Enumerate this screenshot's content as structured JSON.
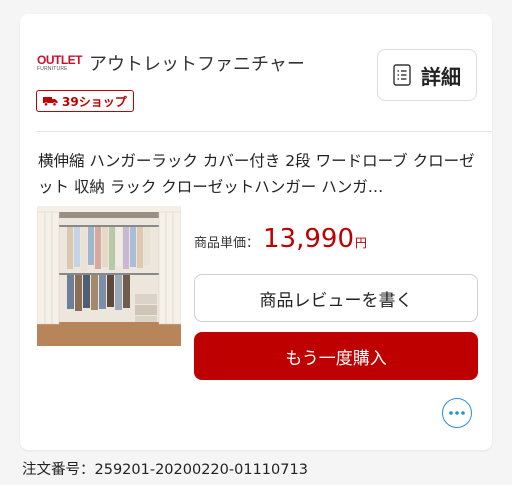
{
  "shop": {
    "logo_line1": "OUTLET",
    "logo_line2": "FURNITURE",
    "name": "アウトレットファニチャー",
    "badge_label": "39ショップ"
  },
  "detail_button": {
    "label": "詳細",
    "icon": "document-list-icon"
  },
  "product": {
    "title": "横伸縮 ハンガーラック カバー付き 2段 ワードローブ クローゼット 収納 ラック クローゼットハンガー ハンガ…",
    "image": "hanger-rack-with-clothes-photo",
    "price_label": "商品単価：",
    "price_value": "13,990",
    "price_unit": "円"
  },
  "actions": {
    "review_label": "商品レビューを書く",
    "rebuy_label": "もう一度購入",
    "more_icon": "ellipsis-circle-icon"
  },
  "order": {
    "number_text": "注文番号：259201-20200220-01110713"
  },
  "colors": {
    "accent_red": "#bf0000",
    "link_blue": "#2c8ed6"
  }
}
